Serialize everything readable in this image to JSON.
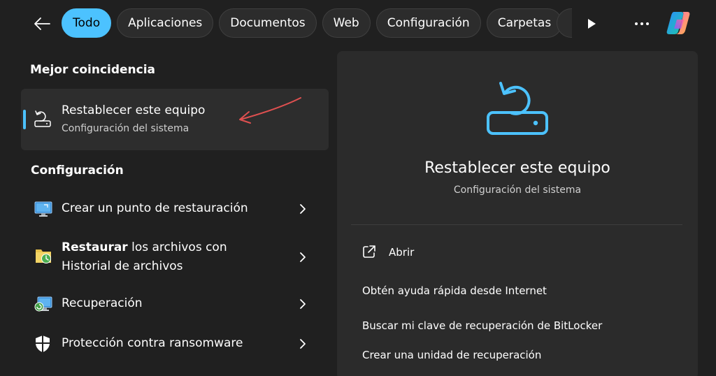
{
  "filters": {
    "tabs": [
      {
        "label": "Todo",
        "active": true
      },
      {
        "label": "Aplicaciones"
      },
      {
        "label": "Documentos"
      },
      {
        "label": "Web"
      },
      {
        "label": "Configuración"
      },
      {
        "label": "Carpetas"
      }
    ]
  },
  "toolbar": {
    "icons": [
      "back-arrow-icon",
      "play-icon",
      "more-icon",
      "copilot-icon"
    ]
  },
  "best_match": {
    "heading": "Mejor coincidencia",
    "title": "Restablecer este equipo",
    "subtitle": "Configuración del sistema"
  },
  "settings": {
    "heading": "Configuración",
    "items": [
      {
        "label": "Crear un punto de restauración"
      },
      {
        "label_bold": "Restaurar",
        "label_rest": " los archivos con",
        "label_line2": "Historial de archivos"
      },
      {
        "label": "Recuperación"
      },
      {
        "label": "Protección contra ransomware"
      }
    ]
  },
  "detail": {
    "title": "Restablecer este equipo",
    "subtitle": "Configuración del sistema",
    "actions": {
      "open": "Abrir",
      "help": "Obtén ayuda rápida desde Internet",
      "bitlocker": "Buscar mi clave de recuperación de BitLocker",
      "recovery_drive": "Crear una unidad de recuperación"
    }
  },
  "colors": {
    "accent": "#4cc2ff",
    "annotation": "#e05050"
  }
}
